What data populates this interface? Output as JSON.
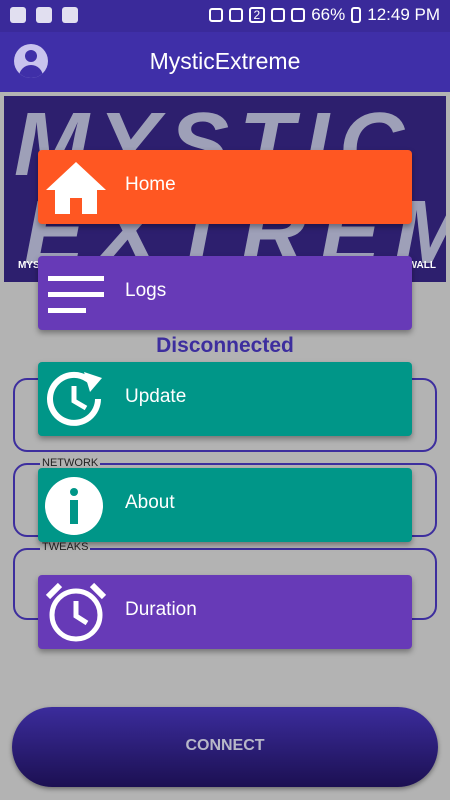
{
  "status_bar": {
    "battery": "66%",
    "time": "12:49 PM",
    "sim": "2"
  },
  "app_bar": {
    "title": "MysticExtreme"
  },
  "banner": {
    "line1": "MYSTIC",
    "line2": "EXTREME",
    "tag_left": "MYS",
    "tag_right": "WALL"
  },
  "connection_status": "Disconnected",
  "sections": {
    "network_label": "NETWORK",
    "tweaks_label": "TWEAKS"
  },
  "menu": [
    {
      "label": "Home",
      "color": "#ff5722",
      "icon": "home-icon"
    },
    {
      "label": "Logs",
      "color": "#673ab7",
      "icon": "list-icon"
    },
    {
      "label": "Update",
      "color": "#009688",
      "icon": "update-icon"
    },
    {
      "label": "About",
      "color": "#009688",
      "icon": "info-icon"
    },
    {
      "label": "Duration",
      "color": "#673ab7",
      "icon": "alarm-clock-icon"
    }
  ],
  "connect_button": {
    "label": "CONNECT"
  }
}
